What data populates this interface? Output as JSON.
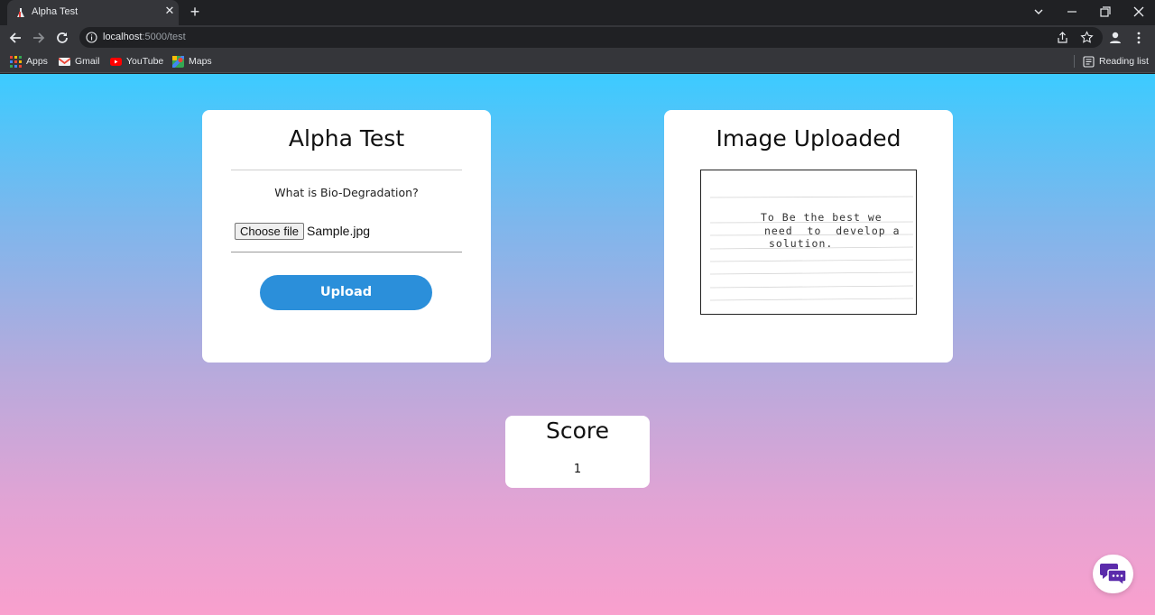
{
  "browser": {
    "tab_title": "Alpha Test",
    "url_host": "localhost",
    "url_rest": ":5000/test",
    "bookmarks": [
      "Apps",
      "Gmail",
      "YouTube",
      "Maps"
    ],
    "reading_list": "Reading list"
  },
  "test_card": {
    "title": "Alpha Test",
    "question": "What is Bio-Degradation?",
    "choose_file_label": "Choose file",
    "file_name": "Sample.jpg",
    "upload_label": "Upload"
  },
  "image_card": {
    "title": "Image Uploaded",
    "handwriting": [
      "To Be the best we",
      "need  to  develop a",
      "solution."
    ]
  },
  "score_card": {
    "title": "Score",
    "value": "1"
  },
  "colors": {
    "accent": "#2b8fda",
    "gradient_top": "#3ccbff",
    "gradient_bottom": "#f9a0cd",
    "chat_icon": "#5b2bab"
  }
}
